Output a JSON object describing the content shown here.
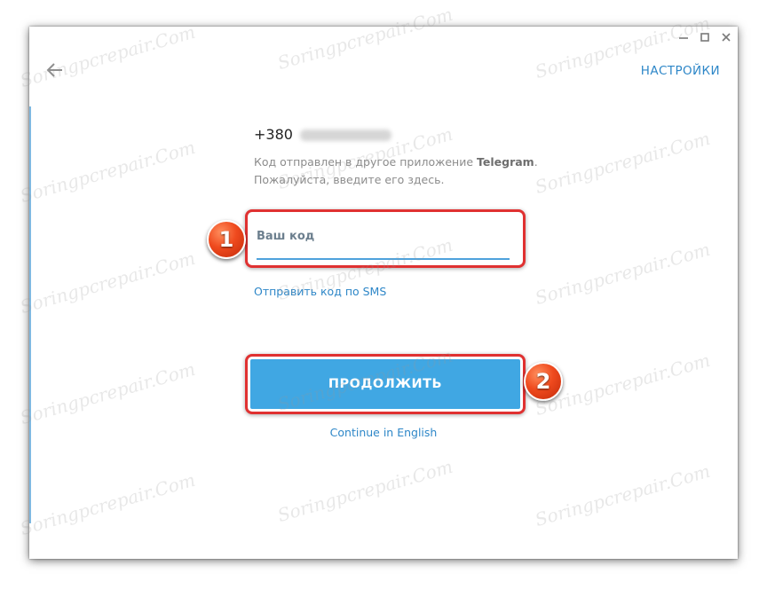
{
  "window": {
    "controls": [
      "minimize-icon",
      "maximize-icon",
      "close-icon"
    ]
  },
  "header": {
    "back_icon": "arrow-left-icon",
    "settings_label": "НАСТРОЙКИ"
  },
  "auth": {
    "phone_prefix": "+380",
    "description_prefix": "Код отправлен в другое приложение ",
    "description_app": "Telegram",
    "description_suffix": ".",
    "description_line2": "Пожалуйста, введите его здесь.",
    "code_placeholder": "Ваш код",
    "code_value": "",
    "sms_link": "Отправить код по SMS",
    "continue_label": "ПРОДОЛЖИТЬ",
    "english_link": "Continue in English"
  },
  "annotations": {
    "step1": "1",
    "step2": "2"
  },
  "watermark": {
    "text": "Soringpcrepair.Com"
  },
  "colors": {
    "accent": "#40a7e3",
    "link": "#2e87c8",
    "highlight": "#e03131",
    "badge": "#ef4a1e"
  }
}
